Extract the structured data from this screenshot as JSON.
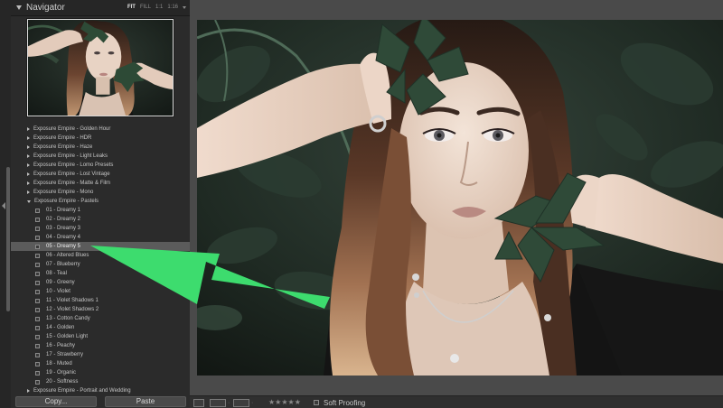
{
  "navigator": {
    "title": "Navigator",
    "zoom_fit": "FIT",
    "zoom_fill": "FILL",
    "zoom_1to1": "1:1",
    "zoom_ratio": "1:16"
  },
  "presets": {
    "folders_before": [
      "Exposure Empire - Golden Hour",
      "Exposure Empire - HDR",
      "Exposure Empire - Haze",
      "Exposure Empire - Light Leaks",
      "Exposure Empire - Lomo Presets",
      "Exposure Empire - Lost Vintage",
      "Exposure Empire - Matte & Film",
      "Exposure Empire - Mono"
    ],
    "open_folder": "Exposure Empire - Pastels",
    "items": [
      "01 - Dreamy 1",
      "02 - Dreamy 2",
      "03 - Dreamy 3",
      "04 - Dreamy 4",
      "05 - Dreamy 5",
      "06 - Altered Blues",
      "07 - Blueberry",
      "08 - Teal",
      "09 - Greeny",
      "10 - Violet",
      "11 - Violet Shadows 1",
      "12 - Violet Shadows 2",
      "13 - Cotton Candy",
      "14 - Golden",
      "15 - Golden Light",
      "16 - Peachy",
      "17 - Strawberry",
      "18 - Muted",
      "19 - Organic",
      "20 - Softness"
    ],
    "selected": "05 - Dreamy 5",
    "folders_after": [
      "Exposure Empire - Portrait and Wedding"
    ]
  },
  "buttons": {
    "copy": "Copy...",
    "paste": "Paste"
  },
  "toolbar": {
    "rating": "★★★★★",
    "soft_proofing": "Soft Proofing"
  },
  "colors": {
    "panel_bg": "#2b2b2b",
    "main_bg": "#4a4a4a",
    "selection": "#5b5b5b",
    "annotation_arrow": "#3ddc6e"
  },
  "icons": {
    "navigator_toggle": "triangle-down-icon",
    "folder_closed": "triangle-right-icon",
    "folder_open": "triangle-down-icon",
    "preset": "preset-doc-icon",
    "annotation": "arrow-icon"
  }
}
